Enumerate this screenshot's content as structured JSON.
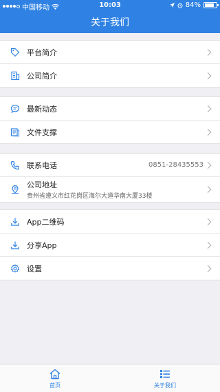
{
  "status": {
    "carrier": "中国移动",
    "time": "10:03",
    "battery": "84%",
    "battery_level": 0.84
  },
  "header": {
    "title": "关于我们"
  },
  "groups": [
    {
      "items": [
        {
          "label": "平台简介",
          "icon": "tag-icon"
        },
        {
          "label": "公司简介",
          "icon": "building-icon"
        }
      ]
    },
    {
      "items": [
        {
          "label": "最新动态",
          "icon": "chat-icon"
        },
        {
          "label": "文件支撑",
          "icon": "document-icon"
        }
      ]
    },
    {
      "items": [
        {
          "label": "联系电话",
          "value": "0851-28435553",
          "icon": "phone-icon"
        },
        {
          "label": "公司地址",
          "sub": "贵州省遵义市红花岗区海尔大道华南大厦33楼",
          "icon": "location-icon"
        }
      ]
    },
    {
      "items": [
        {
          "label": "App二维码",
          "icon": "download-icon"
        },
        {
          "label": "分享App",
          "icon": "download-icon"
        },
        {
          "label": "设置",
          "icon": "gear-icon"
        }
      ]
    }
  ],
  "tabbar": {
    "tabs": [
      {
        "label": "首页",
        "icon": "home-icon"
      },
      {
        "label": "关于我们",
        "icon": "list-icon",
        "active": true
      }
    ]
  },
  "colors": {
    "brand": "#2f82e3",
    "background": "#efeff4"
  }
}
